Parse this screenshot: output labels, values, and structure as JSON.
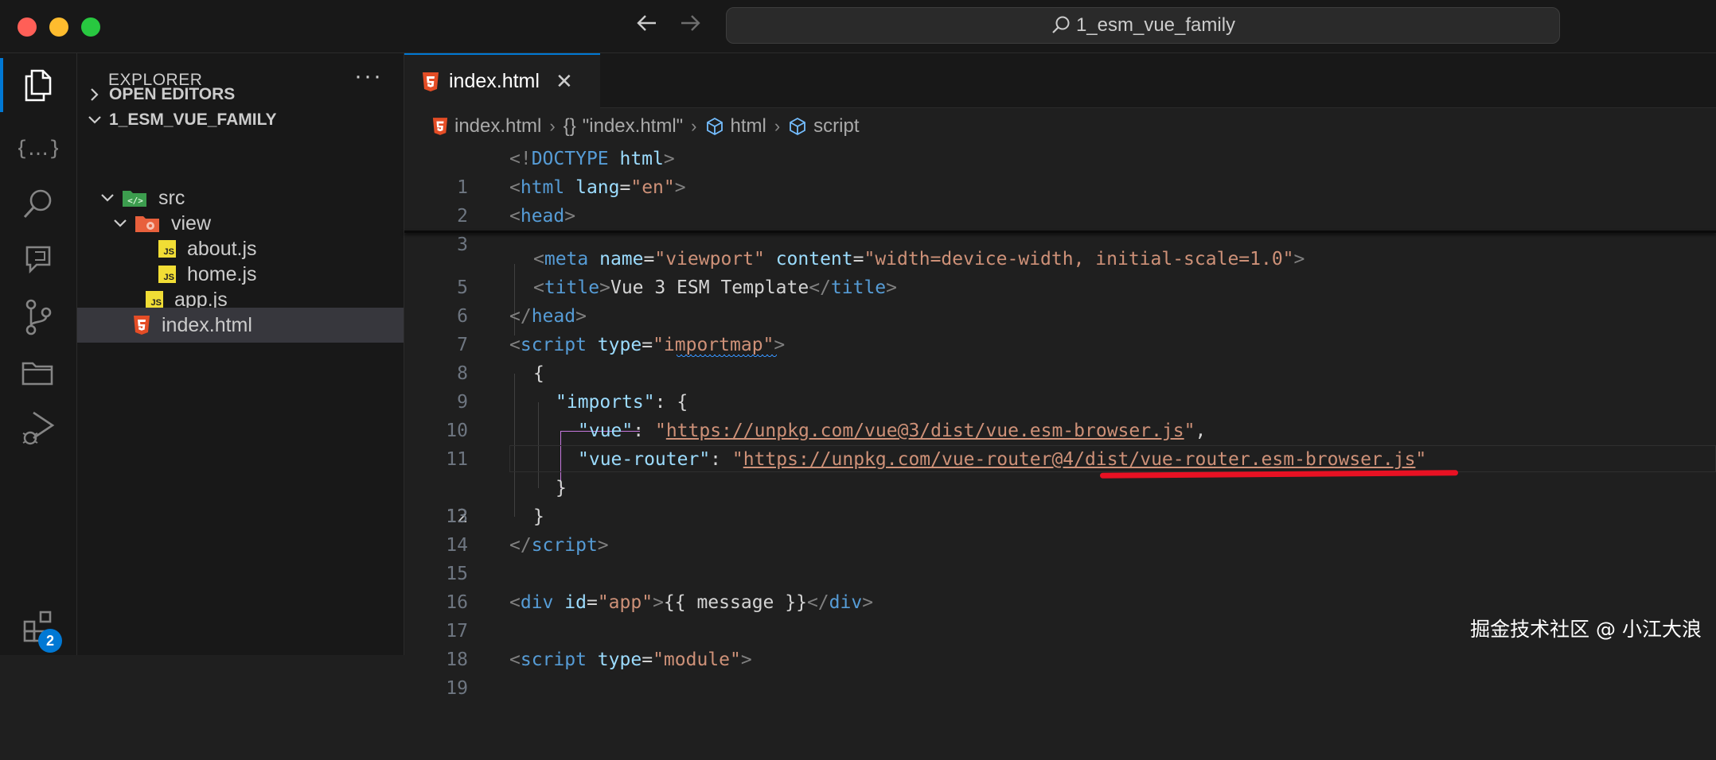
{
  "window": {
    "search_text": "1_esm_vue_family"
  },
  "sidebar": {
    "title": "EXPLORER",
    "more_label": "···",
    "open_editors": "OPEN EDITORS",
    "project": "1_ESM_VUE_FAMILY",
    "tree": [
      {
        "name": "src"
      },
      {
        "name": "view"
      },
      {
        "name": "about.js"
      },
      {
        "name": "home.js"
      },
      {
        "name": "app.js"
      },
      {
        "name": "index.html"
      }
    ]
  },
  "activity": {
    "badge_count": "2"
  },
  "editor": {
    "tab": {
      "label": "index.html",
      "close": "✕"
    },
    "breadcrumb": [
      "index.html",
      "\"index.html\"",
      "html",
      "script"
    ],
    "lines": [
      {
        "n": "1"
      },
      {
        "n": "2"
      },
      {
        "n": "3"
      },
      {
        "n": "5"
      },
      {
        "n": "6"
      },
      {
        "n": "7"
      },
      {
        "n": "8"
      },
      {
        "n": "9"
      },
      {
        "n": "10"
      },
      {
        "n": "11"
      },
      {
        "n": "12"
      },
      {
        "n": "13"
      },
      {
        "n": "14"
      },
      {
        "n": "15"
      },
      {
        "n": "16"
      },
      {
        "n": "17"
      },
      {
        "n": "18"
      },
      {
        "n": "19"
      }
    ],
    "code": {
      "l1": {
        "p1": "<!",
        "tag": "DOCTYPE",
        "attr": " html",
        "p2": ">"
      },
      "l2": {
        "p1": "<",
        "tag": "html",
        "attr": " lang",
        "eq": "=",
        "val": "\"en\"",
        "p2": ">"
      },
      "l3": {
        "p1": "<",
        "tag": "head",
        "p2": ">"
      },
      "l5": {
        "p1": "<",
        "tag": "meta",
        "attr1": " name",
        "eq1": "=",
        "val1": "\"viewport\"",
        "attr2": " content",
        "eq2": "=",
        "val2": "\"width=device-width, initial-scale=1.0\"",
        "p2": ">"
      },
      "l6": {
        "p1": "<",
        "tag": "title",
        "p2": ">",
        "text": "Vue 3 ESM Template",
        "p3": "</",
        "tag2": "title",
        "p4": ">"
      },
      "l7": {
        "p1": "</",
        "tag": "head",
        "p2": ">"
      },
      "l8": {
        "p1": "<",
        "tag": "script",
        "attr": " type",
        "eq": "=",
        "q1": "\"",
        "val": "importmap",
        "q2": "\"",
        "p2": ">"
      },
      "l9": {
        "text": "{"
      },
      "l10": {
        "key": "\"imports\"",
        "rest": ": {"
      },
      "l11": {
        "key": "\"vue\"",
        "colon": ": ",
        "q1": "\"",
        "url": "https://unpkg.com/vue@3/dist/vue.esm-browser.js",
        "q2": "\"",
        "comma": ","
      },
      "l12": {
        "key": "\"vue-router\"",
        "colon": ": ",
        "q1": "\"",
        "url": "https://unpkg.com/vue-router@4/dist/vue-router.esm-browser.js",
        "q2": "\""
      },
      "l13": {
        "text": "}"
      },
      "l14": {
        "text": "}"
      },
      "l15": {
        "p1": "</",
        "tag": "script",
        "p2": ">"
      },
      "l17": {
        "p1": "<",
        "tag": "div",
        "attr": " id",
        "eq": "=",
        "val": "\"app\"",
        "p2": ">",
        "text": "{{ message }}",
        "p3": "</",
        "tag2": "div",
        "p4": ">"
      },
      "l19": {
        "p1": "<",
        "tag": "script",
        "attr": " type",
        "eq": "=",
        "val": "\"module\"",
        "p2": ">"
      }
    }
  },
  "watermark": "掘金技术社区 @ 小江大浪"
}
